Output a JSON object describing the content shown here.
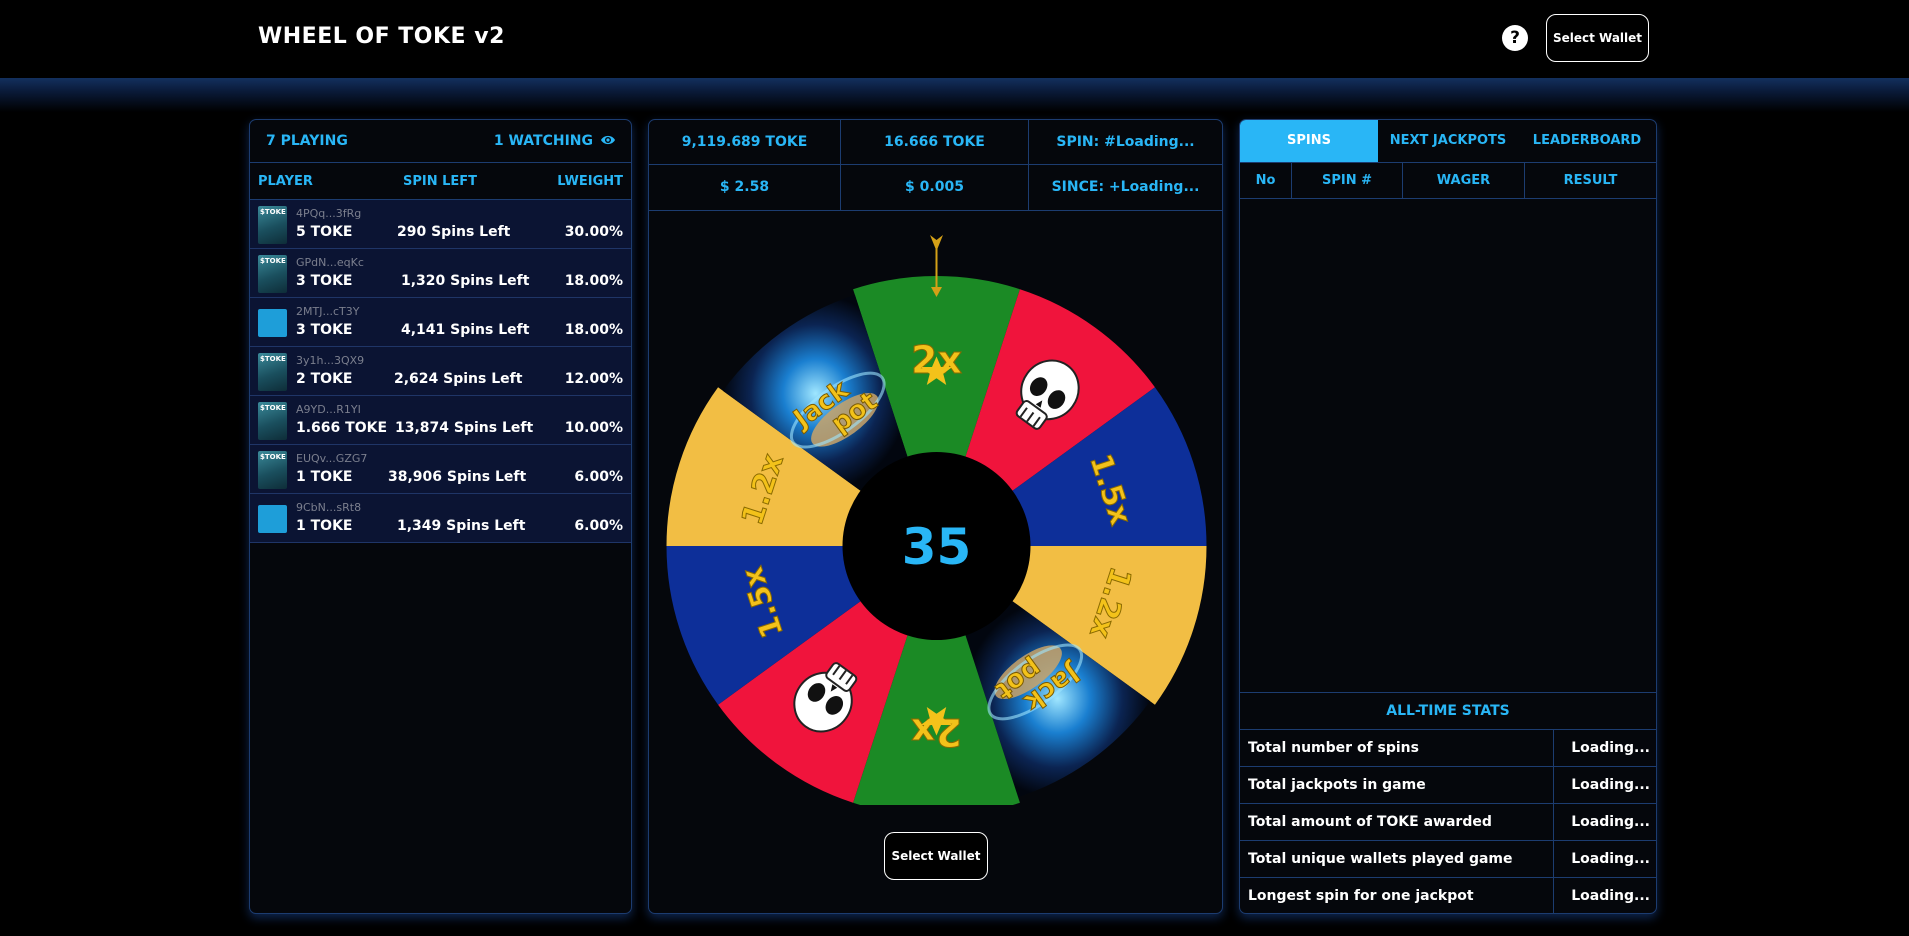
{
  "header": {
    "title": "WHEEL OF TOKE v2",
    "help_label": "?",
    "wallet_button": "Select Wallet"
  },
  "players_panel": {
    "playing": "7 PLAYING",
    "watching": "1 WATCHING",
    "columns": {
      "player": "PLAYER",
      "spin_left": "SPIN LEFT",
      "weight": "LWEIGHT"
    },
    "rows": [
      {
        "address": "4PQq...3fRg",
        "amount": "5 TOKE",
        "spins": "290 Spins Left",
        "weight": "30.00%",
        "avatar": "toke-avatar"
      },
      {
        "address": "GPdN...eqKc",
        "amount": "3 TOKE",
        "spins": "1,320 Spins Left",
        "weight": "18.00%",
        "avatar": "toke-avatar"
      },
      {
        "address": "2MTJ...cT3Y",
        "amount": "3 TOKE",
        "spins": "4,141 Spins Left",
        "weight": "18.00%",
        "avatar": "blue-avatar"
      },
      {
        "address": "3y1h...3QX9",
        "amount": "2 TOKE",
        "spins": "2,624 Spins Left",
        "weight": "12.00%",
        "avatar": "toke-avatar"
      },
      {
        "address": "A9YD...R1YI",
        "amount": "1.666 TOKE",
        "spins": "13,874 Spins Left",
        "weight": "10.00%",
        "avatar": "toke-avatar"
      },
      {
        "address": "EUQv...GZG7",
        "amount": "1 TOKE",
        "spins": "38,906 Spins Left",
        "weight": "6.00%",
        "avatar": "toke-avatar"
      },
      {
        "address": "9CbN...sRt8",
        "amount": "1 TOKE",
        "spins": "1,349 Spins Left",
        "weight": "6.00%",
        "avatar": "blue-avatar"
      }
    ]
  },
  "game_stats": {
    "pot_toke": "9,119.689 TOKE",
    "wager_toke": "16.666 TOKE",
    "spin": "SPIN: #Loading...",
    "pot_usd": "$ 2.58",
    "wager_usd": "$ 0.005",
    "since": "SINCE: +Loading..."
  },
  "wheel": {
    "countdown": "35",
    "colors": {
      "green": "#1b8a25",
      "red": "#f0143c",
      "blue": "#0d2f99",
      "yellow": "#f2be44",
      "label": "#f3c21a",
      "center": "#000000",
      "countdown": "#29b6f6"
    },
    "segments": [
      {
        "type": "multiplier",
        "label": "2x",
        "color": "green"
      },
      {
        "type": "skull",
        "label": "",
        "color": "red"
      },
      {
        "type": "multiplier",
        "label": "1.5x",
        "color": "blue"
      },
      {
        "type": "multiplier",
        "label": "1.2x",
        "color": "yellow"
      },
      {
        "type": "jackpot",
        "label": "Jack pot",
        "color": "image"
      },
      {
        "type": "multiplier",
        "label": "2x",
        "color": "green"
      },
      {
        "type": "skull",
        "label": "",
        "color": "red"
      },
      {
        "type": "multiplier",
        "label": "1.5x",
        "color": "blue"
      },
      {
        "type": "multiplier",
        "label": "1.2x",
        "color": "yellow"
      },
      {
        "type": "jackpot",
        "label": "Jack pot",
        "color": "image"
      }
    ],
    "spin_button": "Select Wallet"
  },
  "right_panel": {
    "tabs": [
      "SPINS",
      "NEXT JACKPOTS",
      "LEADERBOARD"
    ],
    "active_tab": "SPINS",
    "table_columns": [
      "No",
      "SPIN #",
      "WAGER",
      "RESULT"
    ],
    "alltime_title": "ALL-TIME STATS",
    "stats": [
      {
        "label": "Total number of spins",
        "value": "Loading..."
      },
      {
        "label": "Total jackpots in game",
        "value": "Loading..."
      },
      {
        "label": "Total amount of TOKE awarded",
        "value": "Loading..."
      },
      {
        "label": "Total unique wallets played game",
        "value": "Loading..."
      },
      {
        "label": "Longest spin for one jackpot",
        "value": "Loading..."
      }
    ]
  }
}
